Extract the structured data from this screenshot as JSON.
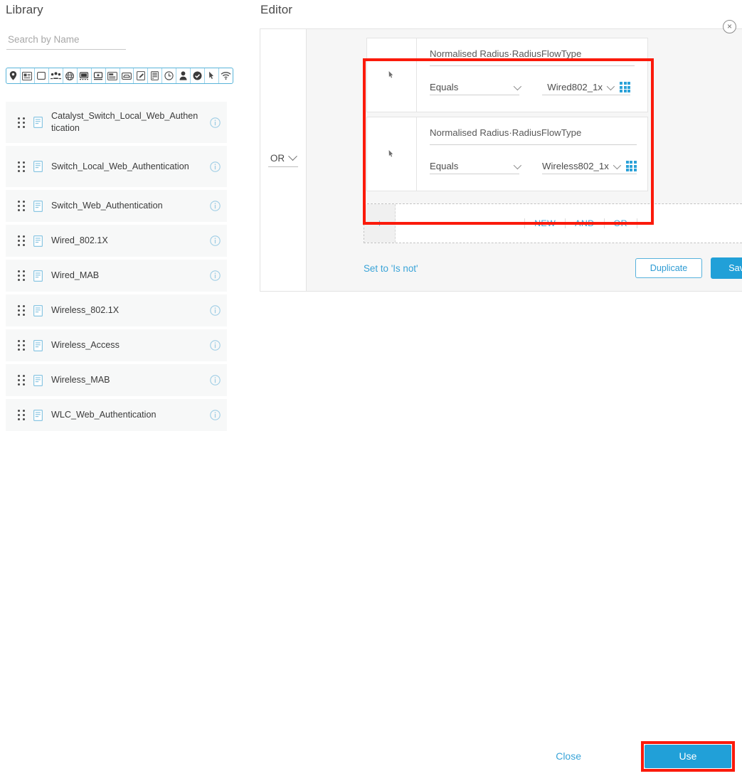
{
  "library": {
    "title": "Library",
    "search": {
      "placeholder": "Search by Name",
      "value": ""
    },
    "toolbar_icons": [
      "location-pin-icon",
      "id-card-icon",
      "square-icon",
      "group-users-icon",
      "globe-icon",
      "desktop-icon",
      "monitor-icon",
      "form-icon",
      "envelope-icon",
      "edit-document-icon",
      "server-icon",
      "clock-icon",
      "person-icon",
      "check-circle-icon",
      "cursor-icon",
      "wifi-icon"
    ],
    "items": [
      {
        "label": "Catalyst_Switch_Local_Web_Authentication",
        "info": "i"
      },
      {
        "label": "Switch_Local_Web_Authentication",
        "info": "i"
      },
      {
        "label": "Switch_Web_Authentication",
        "info": "i"
      },
      {
        "label": "Wired_802.1X",
        "info": "i"
      },
      {
        "label": "Wired_MAB",
        "info": "i"
      },
      {
        "label": "Wireless_802.1X",
        "info": "i"
      },
      {
        "label": "Wireless_Access",
        "info": "i"
      },
      {
        "label": "Wireless_MAB",
        "info": "i"
      },
      {
        "label": "WLC_Web_Authentication",
        "info": "i"
      }
    ]
  },
  "editor": {
    "title": "Editor",
    "logic_operator": "OR",
    "panel_close_label": "×",
    "conditions": [
      {
        "attribute": "Normalised Radius·RadiusFlowType",
        "operator": "Equals",
        "value": "Wired802_1x",
        "remove_label": "×"
      },
      {
        "attribute": "Normalised Radius·RadiusFlowType",
        "operator": "Equals",
        "value": "Wireless802_1x",
        "remove_label": "×"
      }
    ],
    "add_bar": {
      "plus_label": "+",
      "actions": [
        "NEW",
        "AND",
        "OR"
      ]
    },
    "set_is_not_label": "Set to 'Is not'",
    "duplicate_label": "Duplicate",
    "save_label": "Save"
  },
  "footer": {
    "close_label": "Close",
    "use_label": "Use"
  },
  "colors": {
    "accent_blue": "#21a0d8",
    "link_blue": "#3aa4d8",
    "highlight_red": "#fb1a0b",
    "row_bg": "#f7f8f8",
    "panel_bg": "#f6f6f6"
  }
}
